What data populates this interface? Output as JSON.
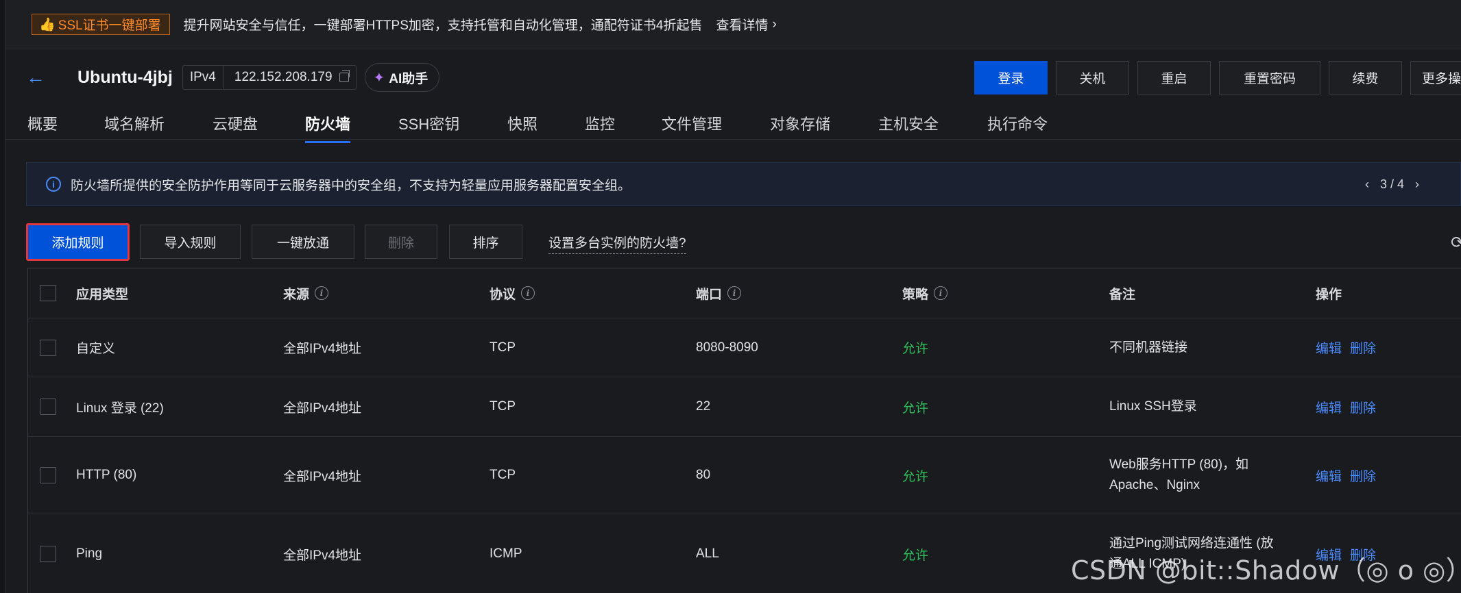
{
  "promo": {
    "tag": "SSL证书一键部署",
    "text": "提升网站安全与信任，一键部署HTTPS加密，支持托管和自动化管理，通配符证书4折起售",
    "link": "查看详情"
  },
  "header": {
    "title": "Ubuntu-4jbj",
    "ip_type": "IPv4",
    "ip": "122.152.208.179",
    "ai_label": "AI助手",
    "actions": [
      "登录",
      "关机",
      "重启",
      "重置密码",
      "续费",
      "更多操"
    ]
  },
  "tabs": [
    "概要",
    "域名解析",
    "云硬盘",
    "防火墙",
    "SSH密钥",
    "快照",
    "监控",
    "文件管理",
    "对象存储",
    "主机安全",
    "执行命令"
  ],
  "active_tab": "防火墙",
  "notice": {
    "text": "防火墙所提供的安全防护作用等同于云服务器中的安全组，不支持为轻量应用服务器配置安全组。",
    "page": "3 / 4"
  },
  "toolbar": {
    "add": "添加规则",
    "import": "导入规则",
    "open_all": "一键放通",
    "delete": "删除",
    "sort": "排序",
    "help": "设置多台实例的防火墙?"
  },
  "table": {
    "columns": [
      "应用类型",
      "来源",
      "协议",
      "端口",
      "策略",
      "备注",
      "操作"
    ],
    "rows": [
      {
        "type": "自定义",
        "source": "全部IPv4地址",
        "protocol": "TCP",
        "port": "8080-8090",
        "policy": "允许",
        "remark1": "不同机器链接",
        "remark2": ""
      },
      {
        "type": "Linux 登录 (22)",
        "source": "全部IPv4地址",
        "protocol": "TCP",
        "port": "22",
        "policy": "允许",
        "remark1": "Linux SSH登录",
        "remark2": ""
      },
      {
        "type": "HTTP (80)",
        "source": "全部IPv4地址",
        "protocol": "TCP",
        "port": "80",
        "policy": "允许",
        "remark1": "Web服务HTTP (80)，如",
        "remark2": "Apache、Nginx"
      },
      {
        "type": "Ping",
        "source": "全部IPv4地址",
        "protocol": "ICMP",
        "port": "ALL",
        "policy": "允许",
        "remark1": "通过Ping测试网络连通性 (放",
        "remark2": "通ALL ICMP)"
      }
    ],
    "op_edit": "编辑",
    "op_delete": "删除"
  },
  "watermark": "CSDN @bit::Shadow（◎ o ◎）",
  "colors": {
    "primary": "#0052d9",
    "allow": "#2ec05a",
    "link": "#4a8cff",
    "promo": "#ff8a2a"
  }
}
